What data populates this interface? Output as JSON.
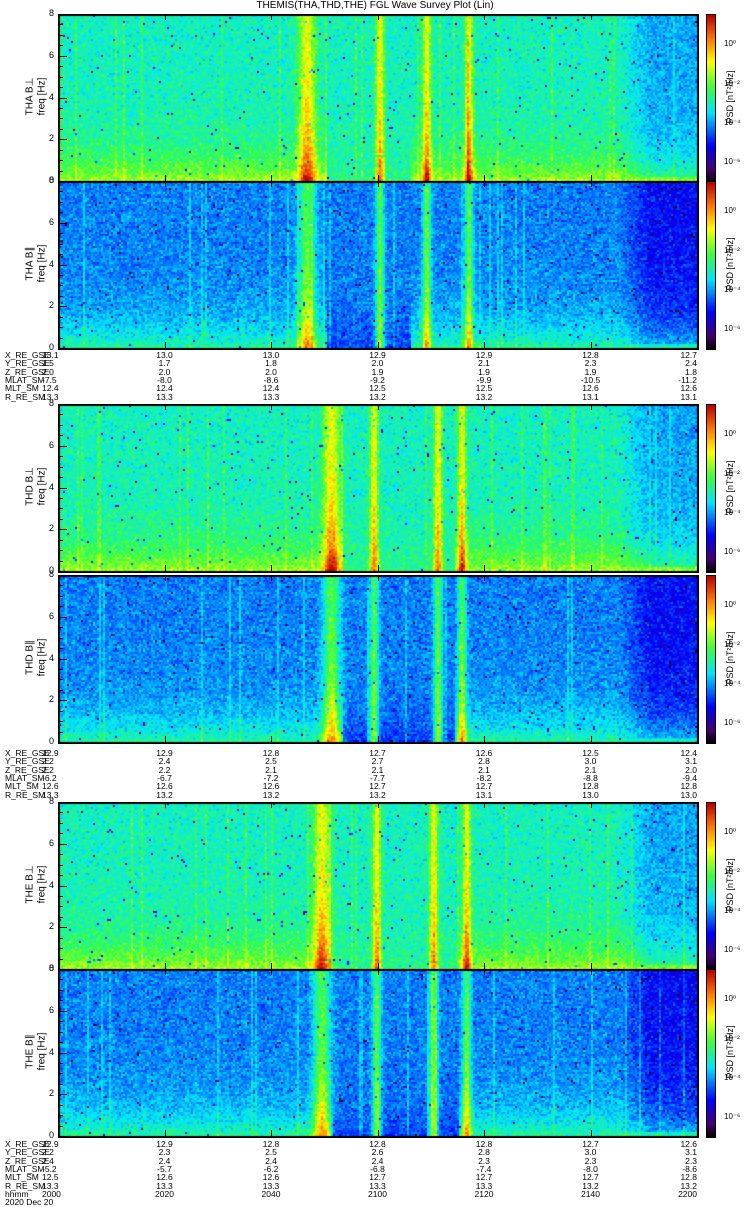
{
  "chart_data": {
    "type": "heatmap",
    "title": "THEMIS(THA,THD,THE) FGL Wave Survey Plot (Lin)",
    "xlabel": "hhmm",
    "date": "2020 Dec 20",
    "x_range_min": [
      0,
      120
    ],
    "x_tick_labels": [
      "2000",
      "2020",
      "2040",
      "2100",
      "2120",
      "2140",
      "2200"
    ],
    "ylim": [
      0,
      8
    ],
    "y_ticks": [
      "0",
      "2",
      "4",
      "6",
      "8"
    ],
    "colorbar": {
      "label": "PSD [nT²/Hz]",
      "range_log10": [
        -7,
        1.5
      ],
      "ticks": [
        "10⁰",
        "10⁻²",
        "10⁻⁴",
        "10⁻⁶"
      ],
      "tick_values": [
        0,
        -2,
        -4,
        -6
      ]
    },
    "panels": [
      {
        "probe": "THA",
        "component": "B⊥",
        "ylabel": "THA B⊥",
        "yunit": "freq [Hz]",
        "band_times_min": [
          46.4,
          60.1,
          68.9,
          76.8
        ],
        "quiet_interval_min": [
          50,
          66
        ]
      },
      {
        "probe": "THA",
        "component": "B∥",
        "ylabel": "THA B∥",
        "yunit": "freq [Hz]",
        "band_times_min": [
          46.4,
          60.1,
          68.9,
          76.8
        ],
        "quiet_interval_min": [
          50,
          66
        ]
      },
      {
        "probe": "THD",
        "component": "B⊥",
        "ylabel": "THD B⊥",
        "yunit": "freq [Hz]",
        "band_times_min": [
          51,
          59,
          71,
          75.5
        ],
        "quiet_interval_min": [
          53,
          74
        ]
      },
      {
        "probe": "THD",
        "component": "B∥",
        "ylabel": "THD B∥",
        "yunit": "freq [Hz]",
        "band_times_min": [
          51,
          59,
          71,
          75.5
        ],
        "quiet_interval_min": [
          53,
          74
        ]
      },
      {
        "probe": "THE",
        "component": "B⊥",
        "ylabel": "THE B⊥",
        "yunit": "freq [Hz]",
        "band_times_min": [
          49.2,
          59.5,
          70.2,
          76.4
        ],
        "quiet_interval_min": [
          51,
          75
        ]
      },
      {
        "probe": "THE",
        "component": "B∥",
        "ylabel": "THE B∥",
        "yunit": "freq [Hz]",
        "band_times_min": [
          49.2,
          59.5,
          70.2,
          76.4
        ],
        "quiet_interval_min": [
          51,
          75
        ]
      }
    ],
    "ephemeris": [
      {
        "probe": "THA",
        "rows": [
          {
            "name": "X_RE_GSE",
            "values": [
              "13.1",
              "13.0",
              "13.0",
              "12.9",
              "12.9",
              "12.8",
              "12.7"
            ]
          },
          {
            "name": "Y_RE_GSE",
            "values": [
              "1.5",
              "1.7",
              "1.8",
              "2.0",
              "2.1",
              "2.3",
              "2.4"
            ]
          },
          {
            "name": "Z_RE_GSE",
            "values": [
              "2.0",
              "2.0",
              "2.0",
              "1.9",
              "1.9",
              "1.9",
              "1.8"
            ]
          },
          {
            "name": "MLAT_SM",
            "values": [
              "-7.5",
              "-8.0",
              "-8.6",
              "-9.2",
              "-9.9",
              "-10.5",
              "-11.2"
            ]
          },
          {
            "name": "MLT_SM",
            "values": [
              "12.4",
              "12.4",
              "12.4",
              "12.5",
              "12.5",
              "12.6",
              "12.6"
            ]
          },
          {
            "name": "R_RE_SM",
            "values": [
              "13.3",
              "13.3",
              "13.3",
              "13.2",
              "13.2",
              "13.1",
              "13.1"
            ]
          }
        ]
      },
      {
        "probe": "THD",
        "rows": [
          {
            "name": "X_RE_GSE",
            "values": [
              "12.9",
              "12.9",
              "12.8",
              "12.7",
              "12.6",
              "12.5",
              "12.4"
            ]
          },
          {
            "name": "Y_RE_GSE",
            "values": [
              "2.2",
              "2.4",
              "2.5",
              "2.7",
              "2.8",
              "3.0",
              "3.1"
            ]
          },
          {
            "name": "Z_RE_GSE",
            "values": [
              "2.2",
              "2.2",
              "2.1",
              "2.1",
              "2.1",
              "2.1",
              "2.0"
            ]
          },
          {
            "name": "MLAT_SM",
            "values": [
              "-6.2",
              "-6.7",
              "-7.2",
              "-7.7",
              "-8.2",
              "-8.8",
              "-9.4"
            ]
          },
          {
            "name": "MLT_SM",
            "values": [
              "12.6",
              "12.6",
              "12.6",
              "12.7",
              "12.7",
              "12.8",
              "12.8"
            ]
          },
          {
            "name": "R_RE_SM",
            "values": [
              "13.3",
              "13.2",
              "13.2",
              "13.2",
              "13.1",
              "13.0",
              "13.0"
            ]
          }
        ]
      },
      {
        "probe": "THE",
        "rows": [
          {
            "name": "X_RE_GSE",
            "values": [
              "12.9",
              "12.9",
              "12.8",
              "12.8",
              "12.8",
              "12.7",
              "12.6"
            ]
          },
          {
            "name": "Y_RE_GSE",
            "values": [
              "2.2",
              "2.3",
              "2.5",
              "2.6",
              "2.8",
              "3.0",
              "3.1"
            ]
          },
          {
            "name": "Z_RE_GSE",
            "values": [
              "2.4",
              "2.4",
              "2.4",
              "2.4",
              "2.3",
              "2.3",
              "2.3"
            ]
          },
          {
            "name": "MLAT_SM",
            "values": [
              "-5.2",
              "-5.7",
              "-6.2",
              "-6.8",
              "-7.4",
              "-8.0",
              "-8.6"
            ]
          },
          {
            "name": "MLT_SM",
            "values": [
              "12.5",
              "12.6",
              "12.6",
              "12.7",
              "12.7",
              "12.7",
              "12.8"
            ]
          },
          {
            "name": "R_RE_SM",
            "values": [
              "13.3",
              "13.3",
              "13.3",
              "13.3",
              "13.3",
              "13.2",
              "13.2"
            ]
          }
        ]
      }
    ]
  }
}
